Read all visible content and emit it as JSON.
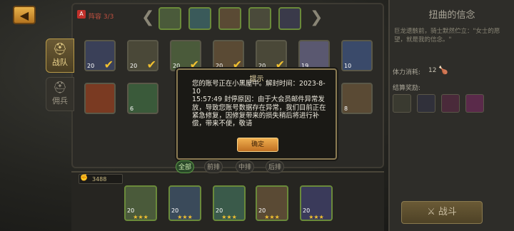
{
  "nav": {
    "back_icon": "arrow-left-icon"
  },
  "side_tabs": [
    {
      "label": "战队",
      "icon": "helmet-icon",
      "active": true
    },
    {
      "label": "佣兵",
      "icon": "helmet-icon",
      "active": false
    }
  ],
  "lineup": {
    "label": "阵容 3/3",
    "badge": "A"
  },
  "hero_grid": {
    "row1_levels": [
      "20",
      "20",
      "20",
      "20",
      "20",
      "19",
      "10"
    ],
    "row2_levels": [
      "",
      "6",
      "",
      "",
      "",
      "",
      "8"
    ]
  },
  "dialog": {
    "title": "提示",
    "body": "您的账号正在小黑屋中。解封时间：2023-8-10\n15:57:49 封停原因：由于大会员邮件异常发放，导致您账号数据存在异常，我们目前正在紧急修复，因修复带来的损失稍后将进行补偿，带来不便，敬请",
    "confirm_label": "确定"
  },
  "filters": [
    "全部",
    "前排",
    "中排",
    "后排"
  ],
  "power": {
    "value": "3488"
  },
  "team": {
    "levels": [
      "20",
      "20",
      "20",
      "20",
      "20"
    ],
    "stars": [
      "★★★",
      "★★★",
      "★★★",
      "★★★",
      "★★★"
    ]
  },
  "artifact": {
    "title": "扭曲的信念",
    "description": "巨龙遗骸前，骑士默然伫立：\"女士的愿望，就是我的信念。\"",
    "stamina_label": "体力消耗:",
    "stamina_value": "12",
    "reward_label": "结算奖励:"
  },
  "battle": {
    "label": "战斗"
  },
  "colors": {
    "accent": "#e9b24a",
    "panel": "#2b2a26",
    "check": "#f0c030"
  }
}
